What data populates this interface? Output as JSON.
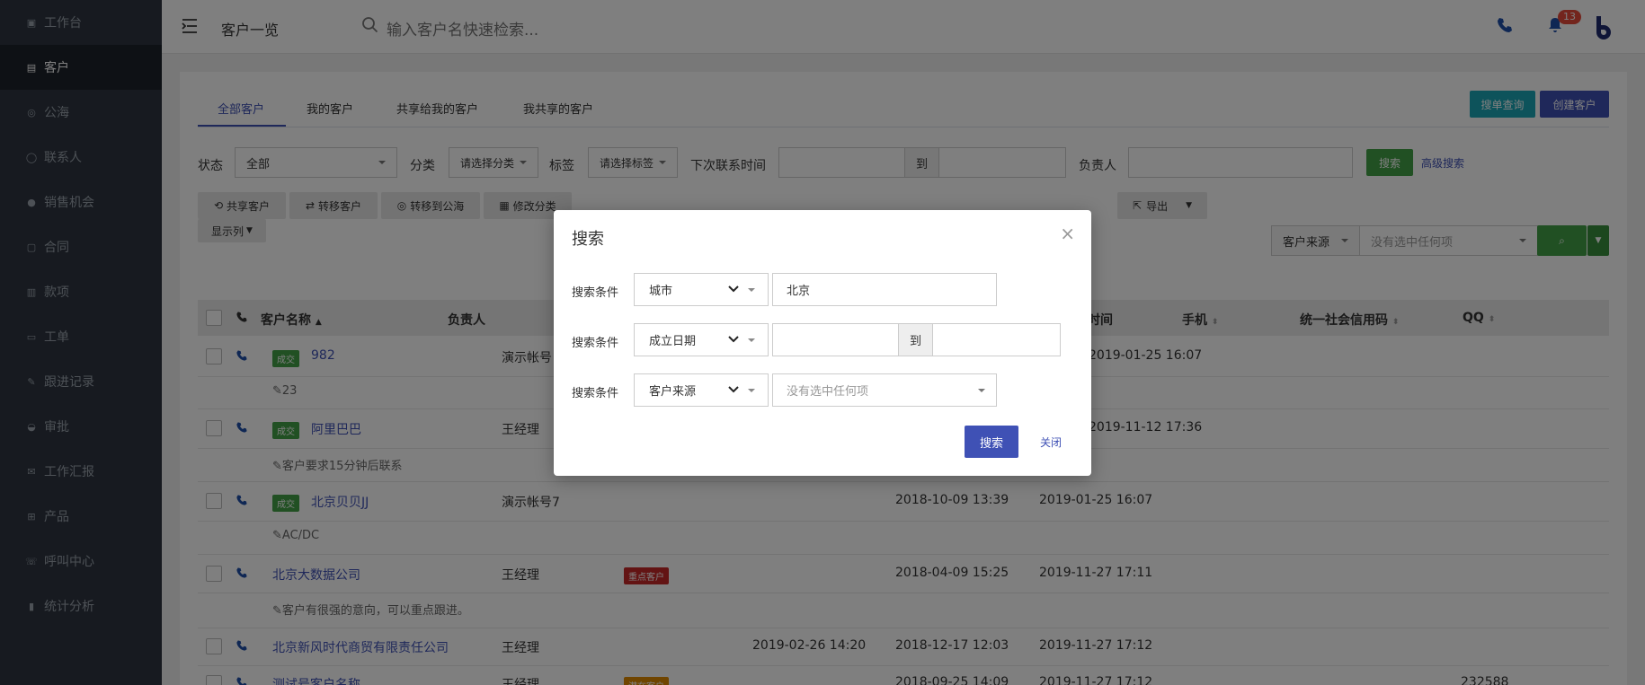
{
  "sidebar": {
    "items": [
      {
        "label": "工作台",
        "icon": "workbench-icon"
      },
      {
        "label": "客户",
        "icon": "customer-icon"
      },
      {
        "label": "公海",
        "icon": "sea-icon"
      },
      {
        "label": "联系人",
        "icon": "contact-icon"
      },
      {
        "label": "销售机会",
        "icon": "opportunity-icon"
      },
      {
        "label": "合同",
        "icon": "contract-icon"
      },
      {
        "label": "款项",
        "icon": "payment-icon"
      },
      {
        "label": "工单",
        "icon": "ticket-icon"
      },
      {
        "label": "跟进记录",
        "icon": "followup-icon"
      },
      {
        "label": "审批",
        "icon": "approval-icon"
      },
      {
        "label": "工作汇报",
        "icon": "report-icon"
      },
      {
        "label": "产品",
        "icon": "product-icon"
      },
      {
        "label": "呼叫中心",
        "icon": "callcenter-icon"
      },
      {
        "label": "统计分析",
        "icon": "stats-icon"
      }
    ],
    "active": "客户"
  },
  "header": {
    "title": "客户一览",
    "search_placeholder": "输入客户名快速检索...",
    "notification_count": "13"
  },
  "tabs": [
    "全部客户",
    "我的客户",
    "共享给我的客户",
    "我共享的客户"
  ],
  "actions": {
    "quick_query": "搜单查询",
    "create": "创建客户"
  },
  "filters": {
    "status_label": "状态",
    "status_value": "全部",
    "category_label": "分类",
    "category_value": "请选择分类",
    "tag_label": "标签",
    "tag_value": "请选择标签",
    "next_contact_label": "下次联系时间",
    "to": "到",
    "owner_label": "负责人",
    "search": "搜索",
    "advanced": "高级搜索"
  },
  "toolbar": {
    "share": "共享客户",
    "transfer": "转移客户",
    "to_sea": "转移到公海",
    "modify": "修改分类",
    "export": "导出",
    "show_columns": "显示列",
    "source_label": "客户来源",
    "source_placeholder": "没有选中任何项"
  },
  "table": {
    "headers": {
      "name": "客户名称",
      "owner": "负责人",
      "time": "时间",
      "mobile": "手机",
      "credit": "统一社会信用码",
      "qq": "QQ"
    },
    "rows": [
      {
        "tag": "成交",
        "tag_color": "green",
        "name": "982",
        "owner": "演示帐号",
        "c1": "",
        "c2": "",
        "c3": "2019-01-25 16:07",
        "note": "23"
      },
      {
        "tag": "成交",
        "tag_color": "green",
        "name": "阿里巴巴",
        "owner": "王经理",
        "c1": "",
        "c2": "",
        "c3": "2019-11-12 17:36",
        "note": "客户要求15分钟后联系"
      },
      {
        "tag": "成交",
        "tag_color": "green",
        "name": "北京贝贝JJ",
        "owner": "演示帐号7",
        "c1": "",
        "c2": "2018-10-09 13:39",
        "c3": "2019-01-25 16:07",
        "note": "AC/DC"
      },
      {
        "tag": "",
        "name": "北京大数据公司",
        "owner": "王经理",
        "badge": "重点客户",
        "c1": "",
        "c2": "2018-04-09 15:25",
        "c3": "2019-11-27 17:11",
        "note": "客户有很强的意向，可以重点跟进。"
      },
      {
        "tag": "",
        "name": "北京新风时代商贸有限责任公司",
        "owner": "王经理",
        "c1": "2019-02-26 14:20",
        "c2": "2018-12-17 12:03",
        "c3": "2019-11-27 17:12",
        "note": ""
      },
      {
        "tag": "",
        "name": "测试号客户名称",
        "owner": "王经理",
        "badge": "潜在客户",
        "c1": "",
        "c2": "2018-09-25 14:09",
        "c3": "2019-11-27 17:12",
        "qq": "232588",
        "note": ""
      }
    ]
  },
  "modal": {
    "title": "搜索",
    "row_label": "搜索条件",
    "rows": [
      {
        "field": "城市",
        "value": "北京"
      },
      {
        "field": "成立日期",
        "to": "到"
      },
      {
        "field": "客户来源",
        "placeholder": "没有选中任何项"
      }
    ],
    "search_button": "搜索",
    "close_button": "关闭"
  },
  "colors": {
    "sidebar": "#2e3540",
    "primary": "#3f51b5",
    "teal": "#1aa6b7",
    "green": "#43a047",
    "red": "#c62828",
    "orange": "#e08a00"
  }
}
